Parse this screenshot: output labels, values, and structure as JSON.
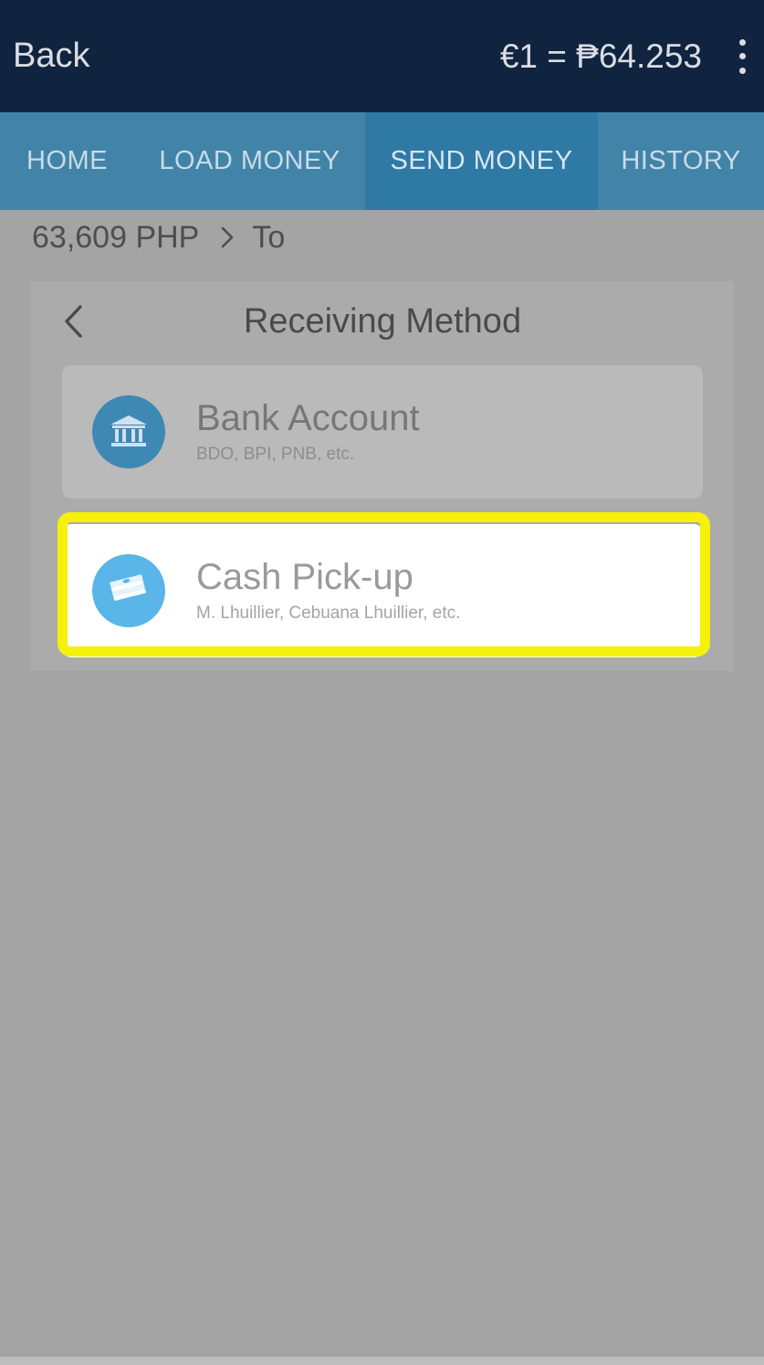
{
  "header": {
    "back_label": "Back",
    "exchange_rate": "€1 = ₱64.253",
    "menu_icon": "more-vertical-icon"
  },
  "tabs": [
    {
      "label": "HOME",
      "active": false
    },
    {
      "label": "LOAD MONEY",
      "active": false
    },
    {
      "label": "SEND MONEY",
      "active": true
    },
    {
      "label": "HISTORY",
      "active": false
    }
  ],
  "breadcrumb": {
    "amount": "63,609 PHP",
    "separator_icon": "chevron-right-icon",
    "destination": "To"
  },
  "receiving_method": {
    "title": "Receiving Method",
    "back_icon": "chevron-left-icon",
    "options": [
      {
        "title": "Bank Account",
        "subtitle": "BDO, BPI, PNB, etc.",
        "icon": "bank-icon",
        "selected": false
      },
      {
        "title": "Cash Pick-up",
        "subtitle": "M. Lhuillier, Cebuana Lhuillier, etc.",
        "icon": "cash-stack-icon",
        "selected": true
      }
    ]
  },
  "colors": {
    "topbar": "#102440",
    "tabbar": "#4284a8",
    "active_tab": "#2f79a5",
    "highlight": "#f6f10a",
    "bank_icon_bg": "#3e88b4",
    "cash_icon_bg": "#5ab5e8"
  }
}
